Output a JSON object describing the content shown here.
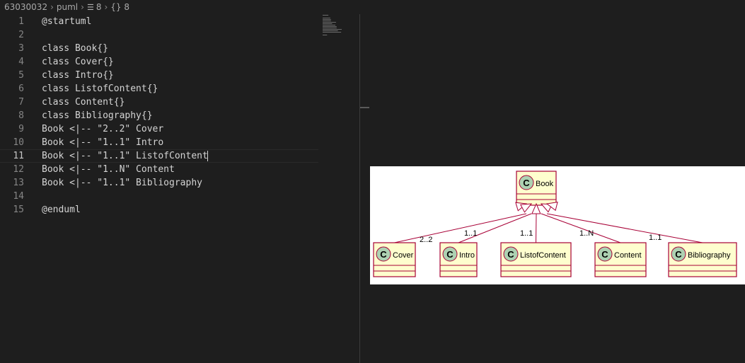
{
  "breadcrumb": {
    "folder": "63030032",
    "file": "puml",
    "symbol1": "8",
    "symbol2": "{} 8"
  },
  "editor": {
    "active_line": 11,
    "lines": [
      {
        "n": "1",
        "text": "@startuml"
      },
      {
        "n": "2",
        "text": ""
      },
      {
        "n": "3",
        "text": "class Book{}"
      },
      {
        "n": "4",
        "text": "class Cover{}"
      },
      {
        "n": "5",
        "text": "class Intro{}"
      },
      {
        "n": "6",
        "text": "class ListofContent{}"
      },
      {
        "n": "7",
        "text": "class Content{}"
      },
      {
        "n": "8",
        "text": "class Bibliography{}"
      },
      {
        "n": "9",
        "text": "Book <|-- \"2..2\" Cover"
      },
      {
        "n": "10",
        "text": "Book <|-- \"1..1\" Intro"
      },
      {
        "n": "11",
        "text": "Book <|-- \"1..1\" ListofContent"
      },
      {
        "n": "12",
        "text": "Book <|-- \"1..N\" Content"
      },
      {
        "n": "13",
        "text": "Book <|-- \"1..1\" Bibliography"
      },
      {
        "n": "14",
        "text": ""
      },
      {
        "n": "15",
        "text": "@enduml"
      }
    ]
  },
  "diagram": {
    "stereotype_letter": "C",
    "parent": "Book",
    "children": [
      {
        "name": "Cover",
        "multiplicity": "2..2"
      },
      {
        "name": "Intro",
        "multiplicity": "1..1"
      },
      {
        "name": "ListofContent",
        "multiplicity": "1..1"
      },
      {
        "name": "Content",
        "multiplicity": "1..N"
      },
      {
        "name": "Bibliography",
        "multiplicity": "1..1"
      }
    ],
    "colors": {
      "class_fill": "#FEFECE",
      "border": "#A80036",
      "circle": "#ADD1B2"
    }
  }
}
